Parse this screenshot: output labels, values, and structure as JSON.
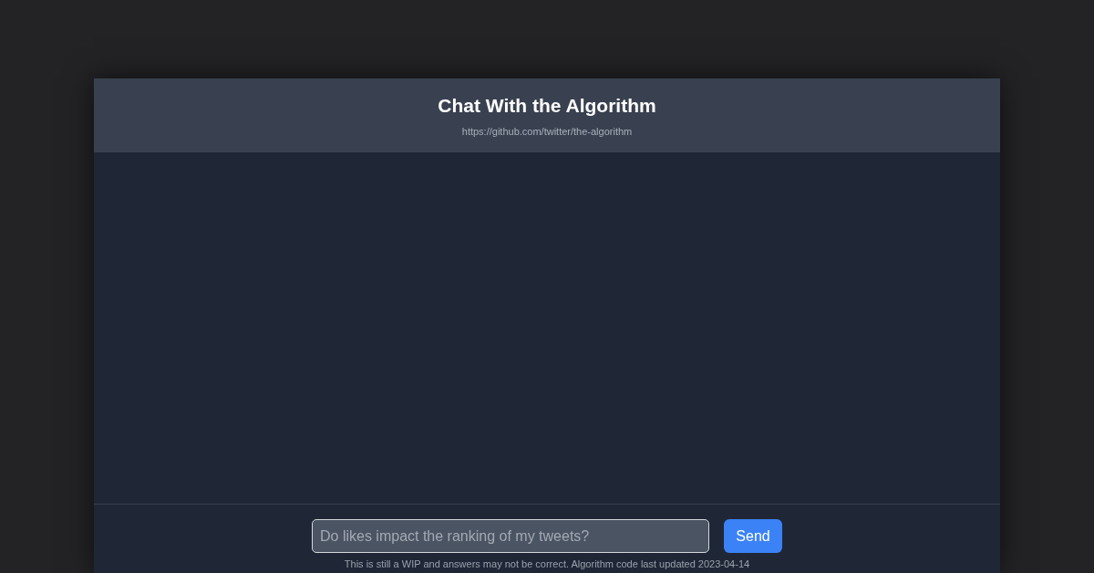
{
  "header": {
    "title": "Chat With the Algorithm",
    "link": "https://github.com/twitter/the-algorithm"
  },
  "composer": {
    "placeholder": "Do likes impact the ranking of my tweets?",
    "button": "Send"
  },
  "footer": {
    "note": "This is still a WIP and answers may not be correct. Algorithm code last updated 2023-04-14"
  }
}
